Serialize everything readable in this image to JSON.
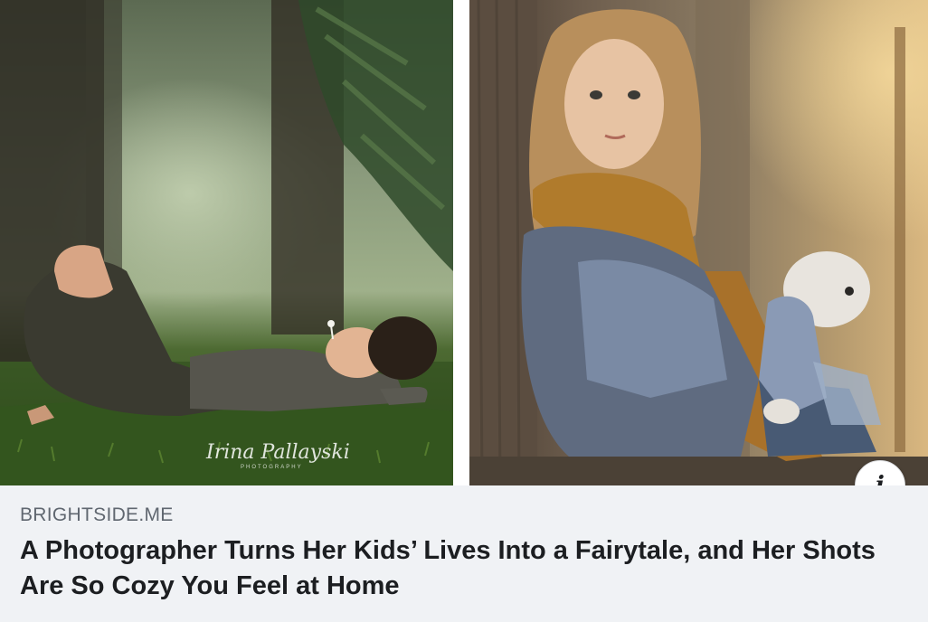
{
  "link_preview": {
    "images": [
      {
        "name": "boy-lying-in-grass-photo"
      },
      {
        "name": "girl-with-toy-bunny-photo"
      }
    ],
    "watermark": {
      "signature": "Irina Pallayski",
      "sub": "PHOTOGRAPHY"
    },
    "info_icon": "info-icon",
    "domain": "BRIGHTSIDE.ME",
    "headline": "A Photographer Turns Her Kids’ Lives Into a Fairytale, and Her Shots Are So Cozy You Feel at Home"
  },
  "colors": {
    "caption_background": "#f0f2f5",
    "domain_text": "#606770",
    "headline_text": "#1c1e21"
  }
}
